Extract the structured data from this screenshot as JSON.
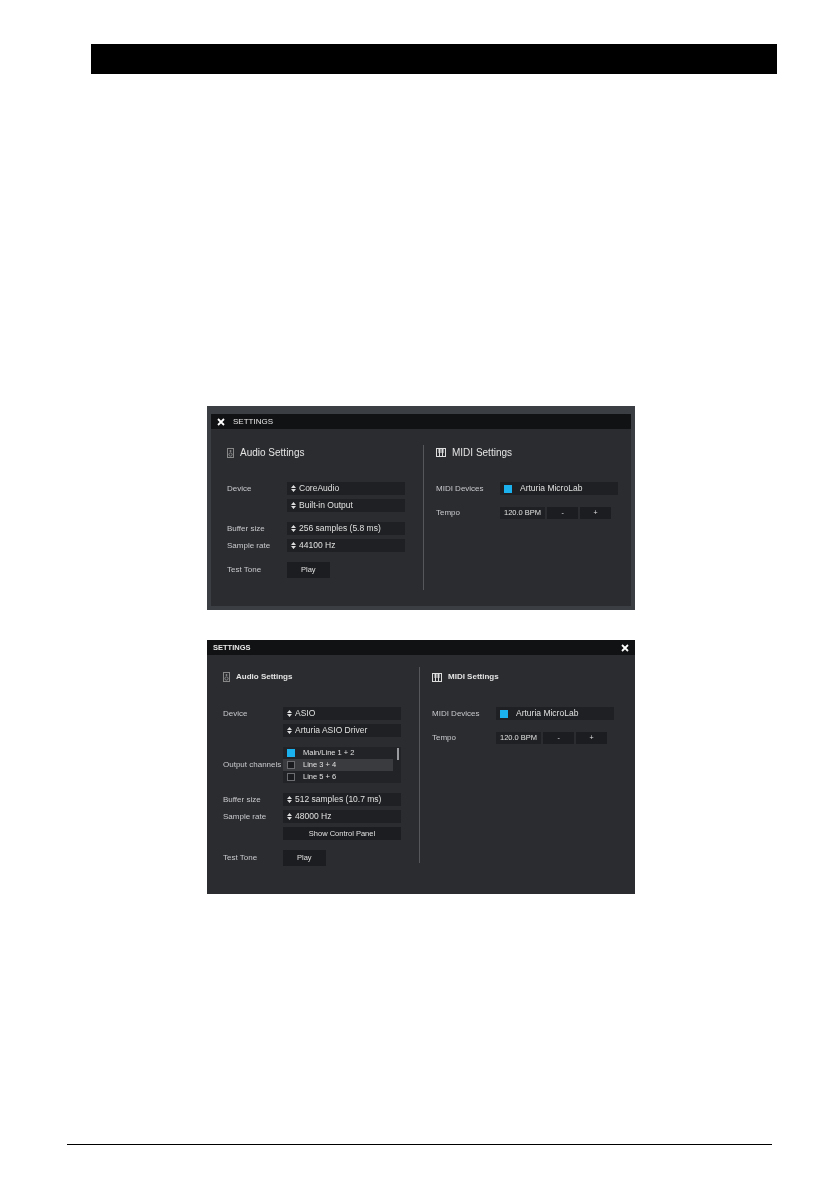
{
  "panels": [
    {
      "kind": "classic",
      "title": "SETTINGS",
      "audio": {
        "heading": "Audio Settings",
        "rows": [
          {
            "kind": "select",
            "label": "Device",
            "value": "CoreAudio"
          },
          {
            "kind": "select",
            "value": "Built-in Output"
          },
          {
            "kind": "select",
            "label": "Buffer size",
            "value": "256 samples (5.8 ms)"
          },
          {
            "kind": "select",
            "label": "Sample rate",
            "value": "44100 Hz"
          },
          {
            "kind": "button",
            "label": "Test Tone",
            "value": "Play"
          }
        ]
      },
      "midi": {
        "heading": "MIDI Settings",
        "devices_label": "MIDI Devices",
        "devices": [
          {
            "label": "Arturia MicroLab",
            "checked": true
          }
        ],
        "tempo_label": "Tempo",
        "tempo": "120.0 BPM",
        "buttons": [
          "-",
          "+"
        ]
      }
    },
    {
      "kind": "modern",
      "title": "SETTINGS",
      "audio": {
        "heading": "Audio Settings",
        "rows": [
          {
            "kind": "select",
            "label": "Device",
            "value": "ASIO"
          },
          {
            "kind": "select",
            "value": "Arturia ASIO Driver"
          },
          {
            "kind": "channels",
            "label": "Output channels",
            "items": [
              {
                "label": "Main/Line 1 + 2",
                "checked": true,
                "selected": false
              },
              {
                "label": "Line 3 + 4",
                "checked": false,
                "selected": true
              },
              {
                "label": "Line 5 + 6",
                "checked": false,
                "selected": false
              }
            ]
          },
          {
            "kind": "select",
            "label": "Buffer size",
            "value": "512 samples (10.7 ms)"
          },
          {
            "kind": "select",
            "label": "Sample rate",
            "value": "48000 Hz"
          },
          {
            "kind": "wide-button",
            "value": "Show Control Panel"
          },
          {
            "kind": "button",
            "label": "Test Tone",
            "value": "Play"
          }
        ]
      },
      "midi": {
        "heading": "MIDI Settings",
        "devices_label": "MIDI Devices",
        "devices": [
          {
            "label": "Arturia MicroLab",
            "checked": true
          }
        ],
        "tempo_label": "Tempo",
        "tempo": "120.0 BPM",
        "buttons": [
          "-",
          "+"
        ]
      }
    }
  ]
}
